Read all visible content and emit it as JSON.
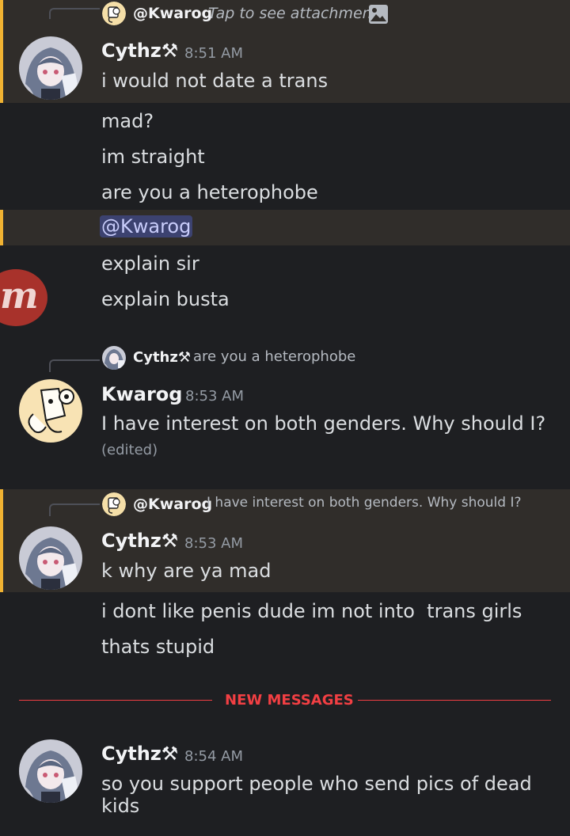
{
  "reply_1": {
    "name": "@Kwarog",
    "text": "Tap to see attachment",
    "icon": "image-icon"
  },
  "group_1": {
    "author": "Cythz⚒",
    "time": "8:51 AM",
    "first": "i would not date a trans"
  },
  "messages_1": [
    "mad?",
    "im straight",
    "are you a heterophobe"
  ],
  "mention_message": "@Kwarog",
  "messages_2": [
    "explain sir",
    "explain busta"
  ],
  "reply_2": {
    "name": "Cythz⚒",
    "text": "are you a heterophobe"
  },
  "group_2": {
    "author": "Kwarog",
    "time": "8:53 AM",
    "text": "I have interest on both genders. Why should I?",
    "edited": "(edited)"
  },
  "reply_3": {
    "name": "@Kwarog",
    "text": "I have interest on both genders. Why should I?"
  },
  "group_3": {
    "author": "Cythz⚒",
    "time": "8:53 AM",
    "first": "k why are ya mad"
  },
  "messages_3": [
    "i dont like penis dude im not into  trans girls",
    "thats stupid"
  ],
  "new_messages_label": "NEW MESSAGES",
  "group_4": {
    "author": "Cythz⚒",
    "time": "8:54 AM",
    "text": "so you support people who send pics of dead kids"
  },
  "floating_logo": "m",
  "colors": {
    "mention_bar": "#f0b232",
    "new_messages": "#f23f43",
    "background": "#1e1f22"
  }
}
